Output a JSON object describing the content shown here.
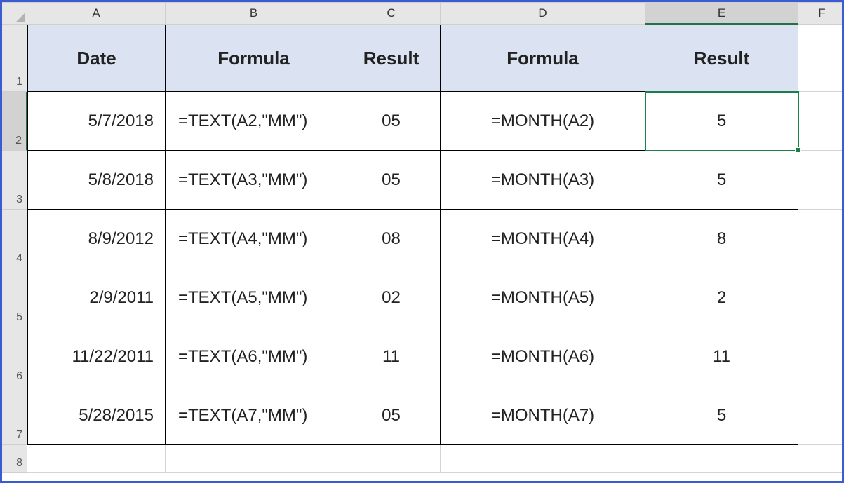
{
  "columnHeaders": [
    "A",
    "B",
    "C",
    "D",
    "E",
    "F"
  ],
  "rowHeaders": [
    "1",
    "2",
    "3",
    "4",
    "5",
    "6",
    "7",
    "8"
  ],
  "selectedCell": "E2",
  "table": {
    "headers": {
      "A": "Date",
      "B": "Formula",
      "C": "Result",
      "D": "Formula",
      "E": "Result"
    },
    "rows": [
      {
        "date": "5/7/2018",
        "formula1": "=TEXT(A2,\"MM\")",
        "result1": "05",
        "formula2": "=MONTH(A2)",
        "result2": "5"
      },
      {
        "date": "5/8/2018",
        "formula1": "=TEXT(A3,\"MM\")",
        "result1": "05",
        "formula2": "=MONTH(A3)",
        "result2": "5"
      },
      {
        "date": "8/9/2012",
        "formula1": "=TEXT(A4,\"MM\")",
        "result1": "08",
        "formula2": "=MONTH(A4)",
        "result2": "8"
      },
      {
        "date": "2/9/2011",
        "formula1": "=TEXT(A5,\"MM\")",
        "result1": "02",
        "formula2": "=MONTH(A5)",
        "result2": "2"
      },
      {
        "date": "11/22/2011",
        "formula1": "=TEXT(A6,\"MM\")",
        "result1": "11",
        "formula2": "=MONTH(A6)",
        "result2": "11"
      },
      {
        "date": "5/28/2015",
        "formula1": "=TEXT(A7,\"MM\")",
        "result1": "05",
        "formula2": "=MONTH(A7)",
        "result2": "5"
      }
    ]
  }
}
